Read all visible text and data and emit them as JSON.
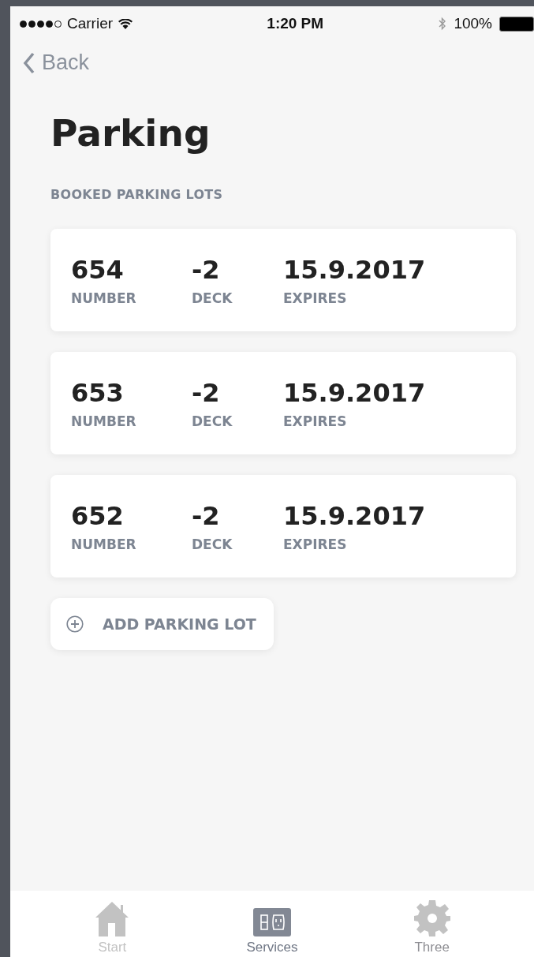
{
  "status_bar": {
    "carrier": "Carrier",
    "time": "1:20 PM",
    "battery": "100%"
  },
  "nav": {
    "back": "Back"
  },
  "title": "Parking",
  "section": "BOOKED PARKING LOTS",
  "lots": [
    {
      "number": "654",
      "number_label": "NUMBER",
      "deck": "-2",
      "deck_label": "DECK",
      "expires": "15.9.2017",
      "expires_label": "EXPIRES"
    },
    {
      "number": "653",
      "number_label": "NUMBER",
      "deck": "-2",
      "deck_label": "DECK",
      "expires": "15.9.2017",
      "expires_label": "EXPIRES"
    },
    {
      "number": "652",
      "number_label": "NUMBER",
      "deck": "-2",
      "deck_label": "DECK",
      "expires": "15.9.2017",
      "expires_label": "EXPIRES"
    }
  ],
  "add_button": "ADD PARKING LOT",
  "tabs": [
    {
      "label": "Start",
      "kind": "home",
      "selected": false,
      "disabled": true
    },
    {
      "label": "Services",
      "kind": "outlet",
      "selected": true,
      "disabled": false
    },
    {
      "label": "Three",
      "kind": "gear",
      "selected": false,
      "disabled": false
    }
  ]
}
